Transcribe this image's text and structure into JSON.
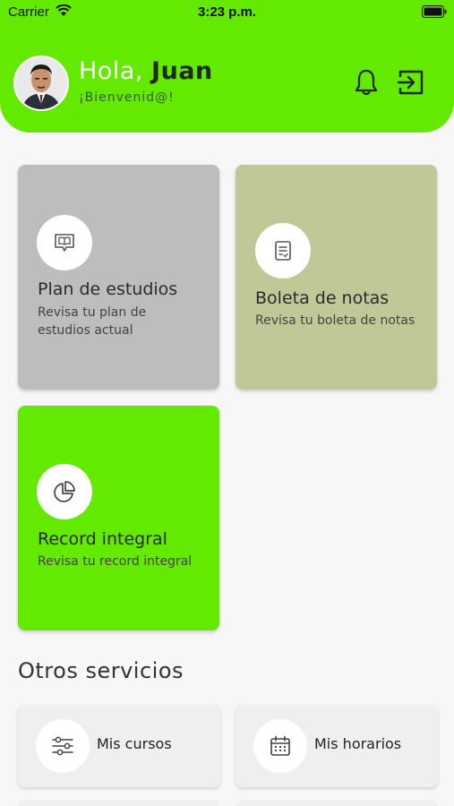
{
  "status_bar": {
    "carrier": "Carrier",
    "time": "3:23 p.m."
  },
  "header": {
    "greeting": "Hola,",
    "name": "Juan",
    "welcome": "¡Bienvenid@!",
    "accent_color": "#63ea00"
  },
  "cards": [
    {
      "title": "Plan de estudios",
      "subtitle": "Revisa tu plan de estudios actual",
      "icon": "book-icon",
      "bg": "#bdbdbd"
    },
    {
      "title": "Boleta de notas",
      "subtitle": "Revisa tu boleta de notas",
      "icon": "report-icon",
      "bg": "#bfc896"
    },
    {
      "title": "Record integral",
      "subtitle": "Revisa tu record integral",
      "icon": "pie-chart-icon",
      "bg": "#63ea00"
    }
  ],
  "other_services": {
    "title": "Otros servicios",
    "items": [
      {
        "label": "Mis cursos",
        "icon": "sliders-icon"
      },
      {
        "label": "Mis horarios",
        "icon": "calendar-icon"
      }
    ]
  }
}
